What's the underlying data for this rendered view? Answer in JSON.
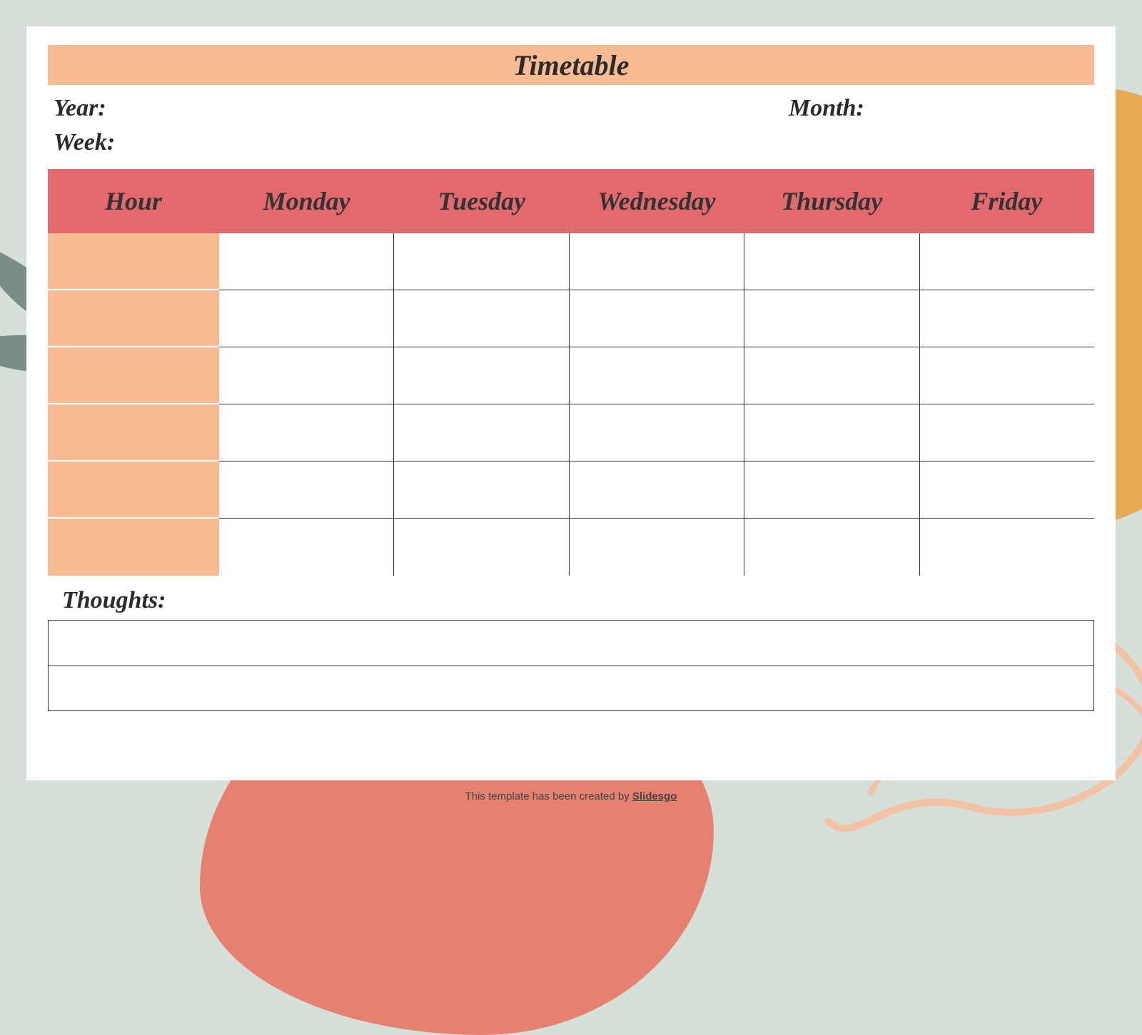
{
  "title": "Timetable",
  "meta": {
    "year_label": "Year:",
    "month_label": "Month:",
    "week_label": "Week:"
  },
  "columns": {
    "hour": "Hour",
    "days": [
      "Monday",
      "Tuesday",
      "Wednesday",
      "Thursday",
      "Friday"
    ]
  },
  "rows": [
    {
      "hour": "",
      "cells": [
        "",
        "",
        "",
        "",
        ""
      ]
    },
    {
      "hour": "",
      "cells": [
        "",
        "",
        "",
        "",
        ""
      ]
    },
    {
      "hour": "",
      "cells": [
        "",
        "",
        "",
        "",
        ""
      ]
    },
    {
      "hour": "",
      "cells": [
        "",
        "",
        "",
        "",
        ""
      ]
    },
    {
      "hour": "",
      "cells": [
        "",
        "",
        "",
        "",
        ""
      ]
    },
    {
      "hour": "",
      "cells": [
        "",
        "",
        "",
        "",
        ""
      ]
    }
  ],
  "thoughts": {
    "label": "Thoughts:",
    "lines": [
      "",
      ""
    ]
  },
  "footer": {
    "text": "This template has been created by ",
    "brand": "Slidesgo"
  },
  "colors": {
    "page_bg": "#d7e0d8",
    "title_bar": "#f8bb92",
    "header_bar": "#e26a6f",
    "hour_col": "#f8bb92"
  }
}
